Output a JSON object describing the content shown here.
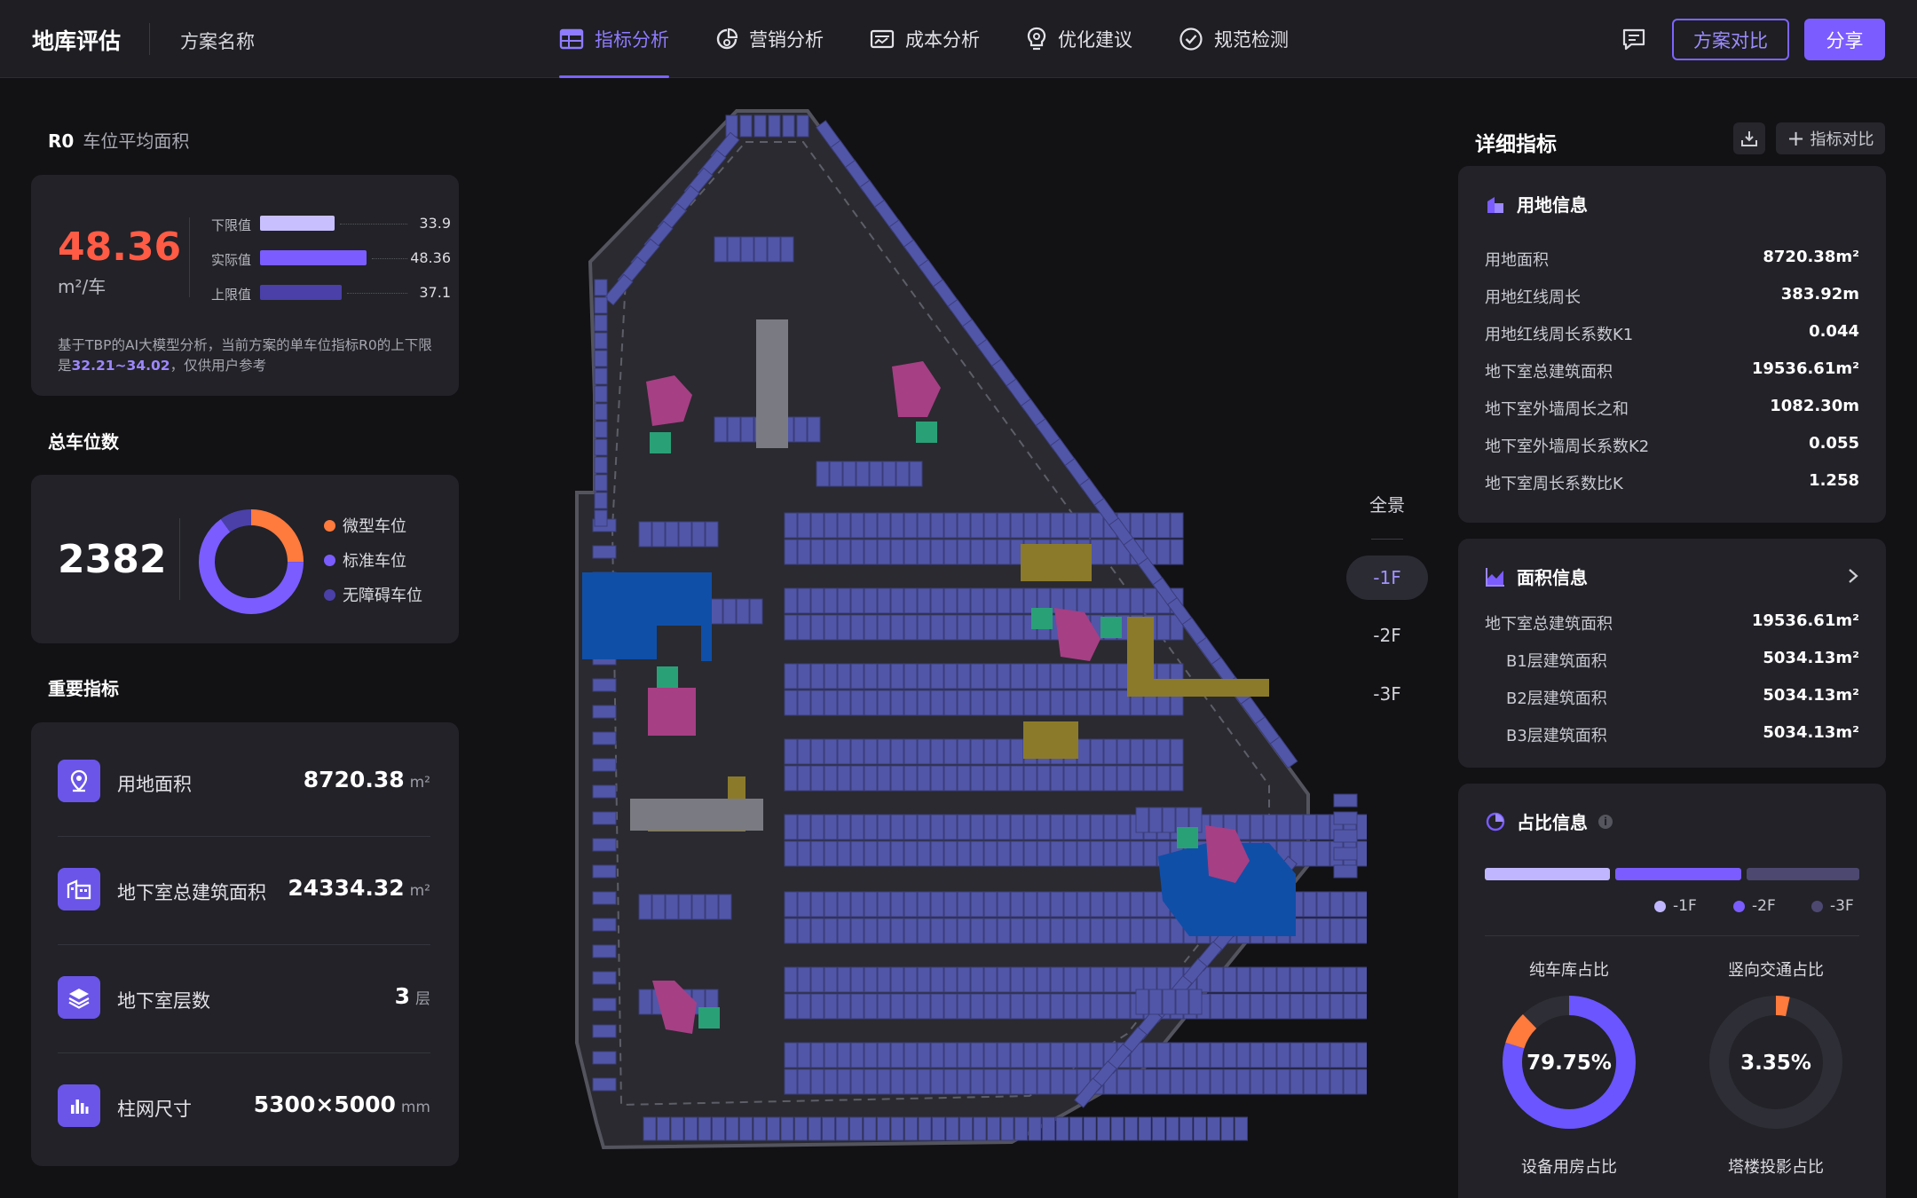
{
  "header": {
    "brand": "地库评估",
    "plan_name": "方案名称",
    "nav": [
      {
        "label": "指标分析",
        "icon": "table-icon",
        "active": true
      },
      {
        "label": "营销分析",
        "icon": "pie-chart-icon",
        "active": false
      },
      {
        "label": "成本分析",
        "icon": "invoice-icon",
        "active": false
      },
      {
        "label": "优化建议",
        "icon": "lightbulb-icon",
        "active": false
      },
      {
        "label": "规范检测",
        "icon": "check-circle-icon",
        "active": false
      }
    ],
    "compare_button": "方案对比",
    "share_button": "分享",
    "accent": "#7b5cff"
  },
  "r0": {
    "code": "R0",
    "title": "车位平均面积",
    "value": "48.36",
    "unit": "m²/车",
    "rows": [
      {
        "label": "下限值",
        "value": "33.9",
        "fraction": 0.7,
        "color": "#c8bfff"
      },
      {
        "label": "实际值",
        "value": "48.36",
        "fraction": 1.0,
        "color": "#7a5cff"
      },
      {
        "label": "上限值",
        "value": "37.1",
        "fraction": 0.77,
        "color": "#4a40a8"
      }
    ],
    "note_prefix": "基于TBP的AI大模型分析，当前方案的单车位指标R0的上下限是",
    "note_range": "32.21~34.02",
    "note_suffix": "，仅供用户参考"
  },
  "parking": {
    "title": "总车位数",
    "total": "2382",
    "legend": [
      {
        "label": "微型车位",
        "color": "#ff7a3d",
        "share": 0.25
      },
      {
        "label": "标准车位",
        "color": "#7a5cff",
        "share": 0.65
      },
      {
        "label": "无障碍车位",
        "color": "#4a40a8",
        "share": 0.1
      }
    ]
  },
  "key_metrics": {
    "title": "重要指标",
    "items": [
      {
        "label": "用地面积",
        "value": "8720.38",
        "unit": "m²",
        "icon": "location-pin-icon"
      },
      {
        "label": "地下室总建筑面积",
        "value": "24334.32",
        "unit": "m²",
        "icon": "building-icon"
      },
      {
        "label": "地下室层数",
        "value": "3",
        "unit": "层",
        "icon": "layers-icon"
      },
      {
        "label": "柱网尺寸",
        "value": "5300×5000",
        "unit": "mm",
        "icon": "bar-chart-icon"
      }
    ]
  },
  "floors": {
    "overview": "全景",
    "levels": [
      "-1F",
      "-2F",
      "-3F"
    ],
    "active": "-1F"
  },
  "details": {
    "title": "详细指标",
    "compare_label": "指标对比",
    "land": {
      "title": "用地信息",
      "rows": [
        {
          "k": "用地面积",
          "v": "8720.38m²"
        },
        {
          "k": "用地红线周长",
          "v": "383.92m"
        },
        {
          "k": "用地红线周长系数K1",
          "v": "0.044"
        },
        {
          "k": "地下室总建筑面积",
          "v": "19536.61m²"
        },
        {
          "k": "地下室外墙周长之和",
          "v": "1082.30m"
        },
        {
          "k": "地下室外墙周长系数K2",
          "v": "0.055"
        },
        {
          "k": "地下室周长系数比K",
          "v": "1.258"
        }
      ]
    },
    "area": {
      "title": "面积信息",
      "rows": [
        {
          "k": "地下室总建筑面积",
          "v": "19536.61m²",
          "indent": false
        },
        {
          "k": "B1层建筑面积",
          "v": "5034.13m²",
          "indent": true
        },
        {
          "k": "B2层建筑面积",
          "v": "5034.13m²",
          "indent": true
        },
        {
          "k": "B3层建筑面积",
          "v": "5034.13m²",
          "indent": true
        }
      ]
    },
    "ratio": {
      "title": "占比信息",
      "bars": [
        {
          "label": "-1F",
          "color": "#c0b6ff",
          "share": 0.345
        },
        {
          "label": "-2F",
          "color": "#7a5cff",
          "share": 0.345
        },
        {
          "label": "-3F",
          "color": "#4c4870",
          "share": 0.31
        }
      ],
      "donuts": [
        {
          "title": "纯车库占比",
          "value": "79.75%",
          "fraction": 0.7975,
          "accent_fraction": 0.08
        },
        {
          "title": "竖向交通占比",
          "value": "3.35%",
          "fraction": 0.0335,
          "accent_fraction": 0
        },
        {
          "title": "设备用房占比"
        },
        {
          "title": "塔楼投影占比"
        }
      ]
    }
  }
}
